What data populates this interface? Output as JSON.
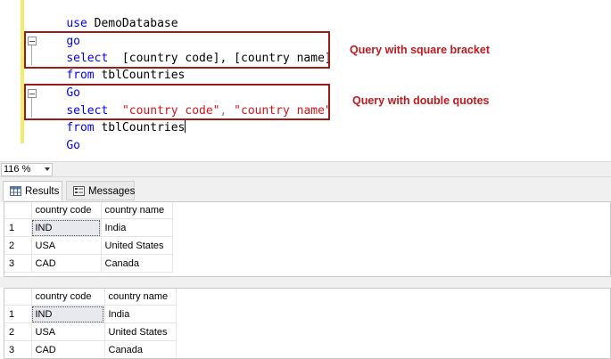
{
  "editor": {
    "lines": [
      {
        "kw": "use",
        "rest": " DemoDatabase"
      },
      {
        "kw": "go",
        "rest": ""
      },
      {
        "kw": "select",
        "rest": "  [country code], [country name]"
      },
      {
        "kw": "from",
        "rest": " tblCountries"
      },
      {
        "kw": "Go",
        "rest": ""
      },
      {
        "kw": "select",
        "rest": "  ",
        "str1": "\"country code\"",
        "sep": ", ",
        "str2": "\"country name\""
      },
      {
        "kw": "from",
        "rest": " tblCountries"
      },
      {
        "kw": "Go",
        "rest": ""
      }
    ],
    "annotations": {
      "square": "Query with square bracket",
      "quotes": "Query with double quotes"
    },
    "colors": {
      "keyword": "#0000ff",
      "string": "#d1151a",
      "highlight_box": "#9b1b1b",
      "annotation": "#c0191f",
      "margin_bar": "#f5ec6a"
    }
  },
  "zoom": {
    "value": "116 %"
  },
  "tabs": {
    "results": "Results",
    "messages": "Messages"
  },
  "grid1": {
    "columns": [
      "country code",
      "country name"
    ],
    "rows": [
      {
        "num": "1",
        "code": "IND",
        "name": "India"
      },
      {
        "num": "2",
        "code": "USA",
        "name": "United States"
      },
      {
        "num": "3",
        "code": "CAD",
        "name": "Canada"
      }
    ]
  },
  "grid2": {
    "columns": [
      "country code",
      "country name"
    ],
    "rows": [
      {
        "num": "1",
        "code": "IND",
        "name": "India"
      },
      {
        "num": "2",
        "code": "USA",
        "name": "United States"
      },
      {
        "num": "3",
        "code": "CAD",
        "name": "Canada"
      }
    ]
  }
}
